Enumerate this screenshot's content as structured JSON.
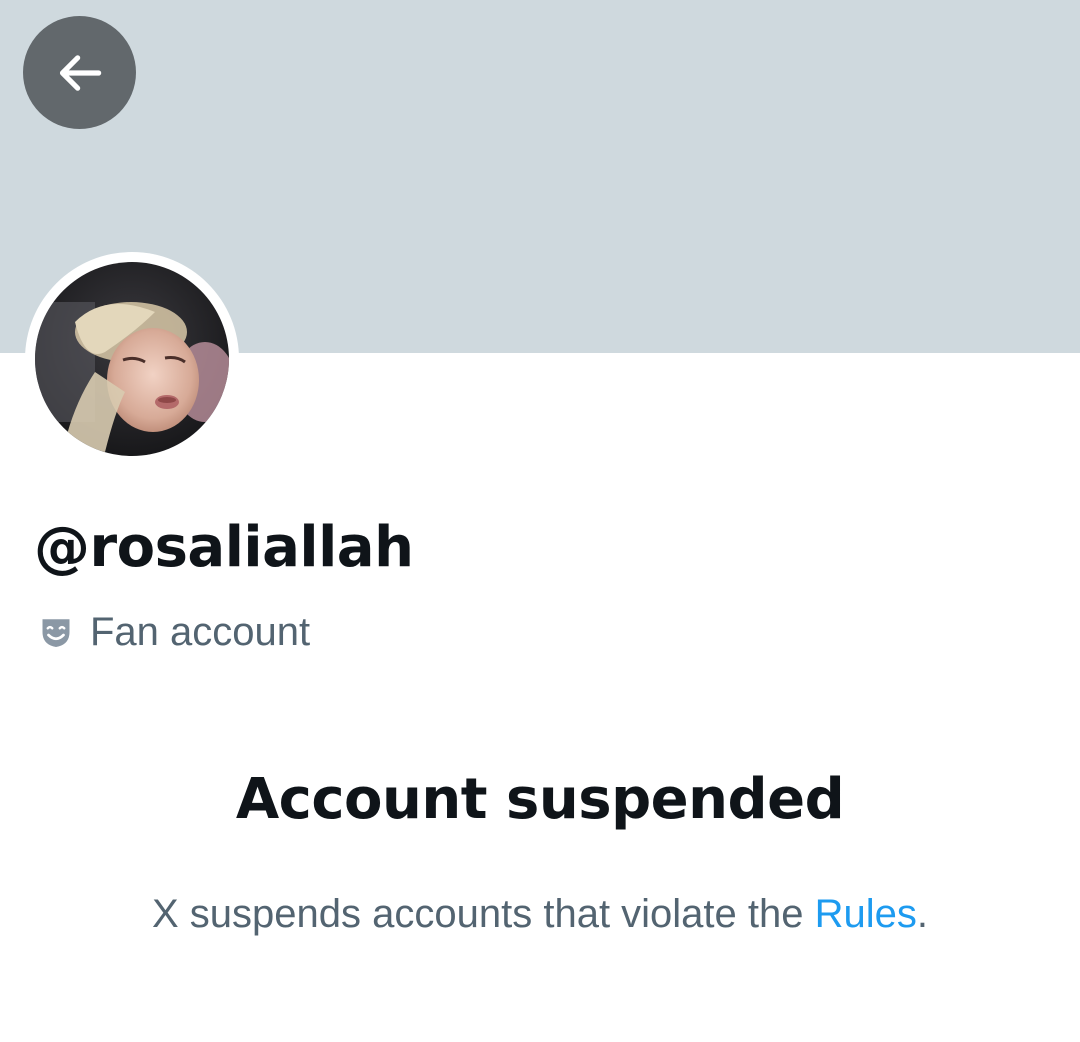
{
  "header": {
    "back_icon": "arrow-left-icon",
    "banner_color": "#cfd9de"
  },
  "profile": {
    "handle": "@rosaliallah",
    "label_icon": "theater-masks-icon",
    "label": "Fan account"
  },
  "suspension": {
    "title": "Account suspended",
    "note_prefix": "X suspends accounts that violate the ",
    "rules_link": "Rules",
    "note_suffix": "."
  },
  "colors": {
    "primary_text": "#0f1419",
    "secondary_text": "#536471",
    "link": "#1d9bf0",
    "back_button_bg": "#62686c"
  }
}
